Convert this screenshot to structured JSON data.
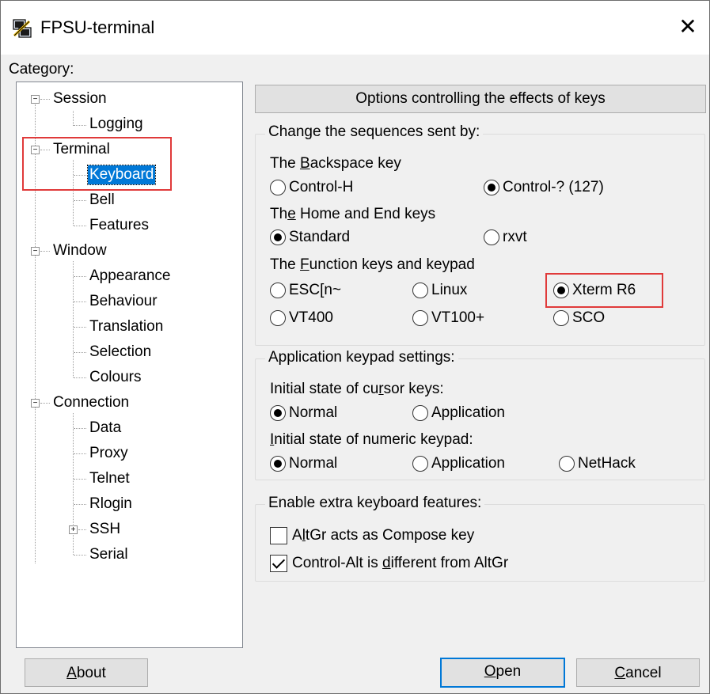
{
  "window": {
    "title": "FPSU-terminal",
    "close_glyph": "✕"
  },
  "category_label": "Category:",
  "tree": {
    "session": "Session",
    "logging": "Logging",
    "terminal": "Terminal",
    "keyboard": "Keyboard",
    "bell": "Bell",
    "features": "Features",
    "window": "Window",
    "appearance": "Appearance",
    "behaviour": "Behaviour",
    "translation": "Translation",
    "selection": "Selection",
    "colours": "Colours",
    "connection": "Connection",
    "data": "Data",
    "proxy": "Proxy",
    "telnet": "Telnet",
    "rlogin": "Rlogin",
    "ssh": "SSH",
    "serial": "Serial",
    "expander_minus": "−",
    "expander_plus": "+"
  },
  "panel_header": "Options controlling the effects of keys",
  "sequences": {
    "title": "Change the sequences sent by:",
    "backspace_label_pre": "The ",
    "backspace_label_u": "B",
    "backspace_label_post": "ackspace key",
    "backspace_opts": [
      "Control-H",
      "Control-? (127)"
    ],
    "homeend_label_pre": "Th",
    "homeend_label_u": "e",
    "homeend_label_post": " Home and End keys",
    "homeend_opts": [
      "Standard",
      "rxvt"
    ],
    "function_label_pre": "The ",
    "function_label_u": "F",
    "function_label_post": "unction keys and keypad",
    "function_opts": [
      "ESC[n~",
      "Linux",
      "Xterm R6",
      "VT400",
      "VT100+",
      "SCO"
    ]
  },
  "app_keypad": {
    "title": "Application keypad settings:",
    "cursor_label_pre": "Initial state of cu",
    "cursor_label_u": "r",
    "cursor_label_post": "sor keys:",
    "cursor_opts": [
      "Normal",
      "Application"
    ],
    "numeric_label_pre": "",
    "numeric_label_u": "I",
    "numeric_label_post": "nitial state of numeric keypad:",
    "numeric_opts": [
      "Normal",
      "Application",
      "NetHack"
    ]
  },
  "extra": {
    "title": "Enable extra keyboard features:",
    "altgr_pre": "A",
    "altgr_u": "l",
    "altgr_post": "tGr acts as Compose key",
    "ctrlalt_pre": "Control-Alt is ",
    "ctrlalt_u": "d",
    "ctrlalt_post": "ifferent from AltGr"
  },
  "buttons": {
    "about_u": "A",
    "about_rest": "bout",
    "open_u": "O",
    "open_rest": "pen",
    "cancel_u": "C",
    "cancel_rest": "ancel"
  },
  "colors": {
    "accent": "#0078d7",
    "highlight_box": "#e03a3a"
  }
}
